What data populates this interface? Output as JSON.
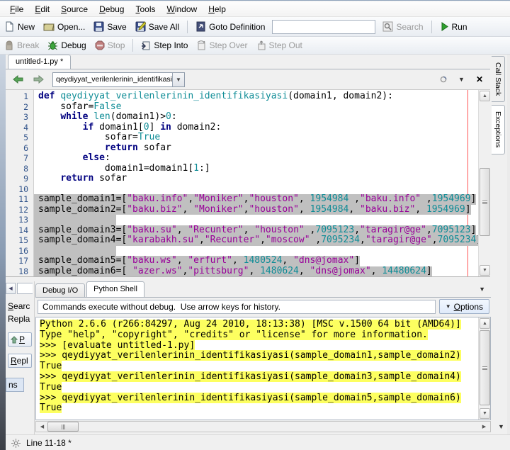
{
  "menu": {
    "items": [
      "File",
      "Edit",
      "Source",
      "Debug",
      "Tools",
      "Window",
      "Help"
    ]
  },
  "toolbar": {
    "new_label": "New",
    "open_label": "Open...",
    "save_label": "Save",
    "save_all_label": "Save All",
    "goto_definition_label": "Goto Definition",
    "search_value": "",
    "search_label": "Search",
    "run_label": "Run"
  },
  "debug_toolbar": {
    "break_label": "Break",
    "debug_label": "Debug",
    "stop_label": "Stop",
    "step_into_label": "Step Into",
    "step_over_label": "Step Over",
    "step_out_label": "Step Out"
  },
  "editor": {
    "tab_label": "untitled-1.py *",
    "nav_combo_value": "qeydiyyat_verilenlerinin_identifikasiyasi",
    "lines": [
      {
        "n": "1",
        "sel": false,
        "t": [
          [
            "kw",
            "def "
          ],
          [
            "fn",
            "qeydiyyat_verilenlerinin_identifikasiyasi"
          ],
          [
            "pl",
            "(domain1, domain2):"
          ]
        ]
      },
      {
        "n": "2",
        "sel": false,
        "t": [
          [
            "pl",
            "    sofar="
          ],
          [
            "num",
            "False"
          ]
        ]
      },
      {
        "n": "3",
        "sel": false,
        "t": [
          [
            "pl",
            "    "
          ],
          [
            "kw",
            "while "
          ],
          [
            "fn",
            "len"
          ],
          [
            "pl",
            "(domain1)>"
          ],
          [
            "num",
            "0"
          ],
          [
            "pl",
            ":"
          ]
        ]
      },
      {
        "n": "4",
        "sel": false,
        "t": [
          [
            "pl",
            "        "
          ],
          [
            "kw",
            "if "
          ],
          [
            "pl",
            "domain1["
          ],
          [
            "num",
            "0"
          ],
          [
            "pl",
            "] "
          ],
          [
            "kw",
            "in"
          ],
          [
            "pl",
            " domain2:"
          ]
        ]
      },
      {
        "n": "5",
        "sel": false,
        "t": [
          [
            "pl",
            "            sofar="
          ],
          [
            "num",
            "True"
          ]
        ]
      },
      {
        "n": "6",
        "sel": false,
        "t": [
          [
            "pl",
            "            "
          ],
          [
            "kw",
            "return"
          ],
          [
            "pl",
            " sofar"
          ]
        ]
      },
      {
        "n": "7",
        "sel": false,
        "t": [
          [
            "pl",
            "        "
          ],
          [
            "kw",
            "else"
          ],
          [
            "pl",
            ":"
          ]
        ]
      },
      {
        "n": "8",
        "sel": false,
        "t": [
          [
            "pl",
            "            domain1=domain1["
          ],
          [
            "num",
            "1"
          ],
          [
            "pl",
            ":]"
          ]
        ]
      },
      {
        "n": "9",
        "sel": false,
        "t": [
          [
            "pl",
            "    "
          ],
          [
            "kw",
            "return"
          ],
          [
            "pl",
            " sofar"
          ]
        ]
      },
      {
        "n": "10",
        "sel": false,
        "t": []
      },
      {
        "n": "11",
        "sel": true,
        "t": [
          [
            "pl",
            "sample_domain1=["
          ],
          [
            "str",
            "\"baku.info\""
          ],
          [
            "pl",
            ","
          ],
          [
            "str",
            "\"Moniker\""
          ],
          [
            "pl",
            ","
          ],
          [
            "str",
            "\"houston\""
          ],
          [
            "pl",
            ", "
          ],
          [
            "num",
            "1954984"
          ],
          [
            "pl",
            " ,"
          ],
          [
            "str",
            "\"baku.info\""
          ],
          [
            "pl",
            " ,"
          ],
          [
            "num",
            "1954969"
          ],
          [
            "pl",
            "]"
          ]
        ]
      },
      {
        "n": "12",
        "sel": true,
        "t": [
          [
            "pl",
            "sample_domain2=["
          ],
          [
            "str",
            "\"baku.biz\""
          ],
          [
            "pl",
            ", "
          ],
          [
            "str",
            "\"Moniker\""
          ],
          [
            "pl",
            ","
          ],
          [
            "str",
            "\"houston\""
          ],
          [
            "pl",
            ", "
          ],
          [
            "num",
            "1954984"
          ],
          [
            "pl",
            ", "
          ],
          [
            "str",
            "\"baku.biz\""
          ],
          [
            "pl",
            ", "
          ],
          [
            "num",
            "1954969"
          ],
          [
            "pl",
            "]"
          ]
        ]
      },
      {
        "n": "13",
        "sel": true,
        "t": []
      },
      {
        "n": "14",
        "sel": true,
        "t": [
          [
            "pl",
            "sample_domain3=["
          ],
          [
            "str",
            "\"baku.su\""
          ],
          [
            "pl",
            ", "
          ],
          [
            "str",
            "\"Recunter\""
          ],
          [
            "pl",
            ", "
          ],
          [
            "str",
            "\"houston\""
          ],
          [
            "pl",
            " ,"
          ],
          [
            "num",
            "7095123"
          ],
          [
            "pl",
            ","
          ],
          [
            "str",
            "\"taragir@ge\""
          ],
          [
            "pl",
            ","
          ],
          [
            "num",
            "7095123"
          ],
          [
            "pl",
            "]"
          ]
        ]
      },
      {
        "n": "15",
        "sel": true,
        "t": [
          [
            "pl",
            "sample_domain4=["
          ],
          [
            "str",
            "\"karabakh.su\""
          ],
          [
            "pl",
            ","
          ],
          [
            "str",
            "\"Recunter\""
          ],
          [
            "pl",
            ","
          ],
          [
            "str",
            "\"moscow\""
          ],
          [
            "pl",
            " ,"
          ],
          [
            "num",
            "7095234"
          ],
          [
            "pl",
            ","
          ],
          [
            "str",
            "\"taragir@ge\""
          ],
          [
            "pl",
            ","
          ],
          [
            "num",
            "7095234"
          ],
          [
            "pl",
            "]"
          ]
        ]
      },
      {
        "n": "16",
        "sel": true,
        "t": []
      },
      {
        "n": "17",
        "sel": true,
        "t": [
          [
            "pl",
            "sample_domain5=["
          ],
          [
            "str",
            "\"baku.ws\""
          ],
          [
            "pl",
            ", "
          ],
          [
            "str",
            "\"erfurt\""
          ],
          [
            "pl",
            ", "
          ],
          [
            "num",
            "1480524"
          ],
          [
            "pl",
            ", "
          ],
          [
            "str",
            "\"dns@jomax\""
          ],
          [
            "pl",
            "]"
          ]
        ]
      },
      {
        "n": "18",
        "sel": true,
        "t": [
          [
            "pl",
            "sample_domain6=[ "
          ],
          [
            "str",
            "\"azer.ws\""
          ],
          [
            "pl",
            ","
          ],
          [
            "str",
            "\"pittsburg\""
          ],
          [
            "pl",
            ", "
          ],
          [
            "num",
            "1480624"
          ],
          [
            "pl",
            ", "
          ],
          [
            "str",
            "\"dns@jomax\""
          ],
          [
            "pl",
            ", "
          ],
          [
            "num",
            "14480624"
          ],
          [
            "pl",
            "]"
          ]
        ]
      }
    ]
  },
  "right_dock": {
    "tabs": [
      "Call Stack",
      "Exceptions"
    ]
  },
  "left_dock": {
    "search_label": "Searc",
    "replace_label": "Repla",
    "prev_button_label": "P",
    "replace_button_label": "Repl",
    "corner_label": "ns"
  },
  "shell": {
    "tabs": [
      "Debug I/O",
      "Python Shell"
    ],
    "active_tab": "Python Shell",
    "info_text": "Commands execute without debug.  Use arrow keys for history.",
    "options_label": "Options",
    "lines": [
      "Python 2.6.6 (r266:84297, Aug 24 2010, 18:13:38) [MSC v.1500 64 bit (AMD64)]",
      "Type \"help\", \"copyright\", \"credits\" or \"license\" for more information.",
      ">>> [evaluate untitled-1.py]",
      ">>> qeydiyyat_verilenlerinin_identifikasiyasi(sample_domain1,sample_domain2)",
      "True",
      ">>> qeydiyyat_verilenlerinin_identifikasiyasi(sample_domain3,sample_domain4)",
      "True",
      ">>> qeydiyyat_verilenlerinin_identifikasiyasi(sample_domain5,sample_domain6)",
      "True"
    ]
  },
  "status_bar": {
    "line_info": "Line 11-18 *"
  },
  "colors": {
    "keyword": "#000080",
    "string": "#990099",
    "number_builtin": "#0E8C96",
    "selection": "#C0C0C0",
    "shell_highlight": "#FDFF60",
    "margin_line": "#FF5555"
  }
}
